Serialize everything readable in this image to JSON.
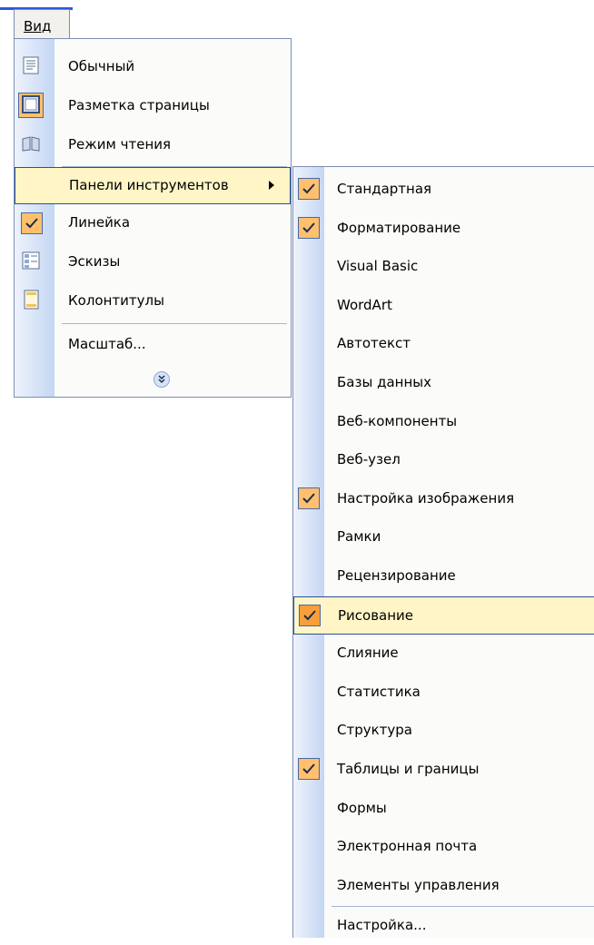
{
  "menubar": {
    "view_label": "Вид"
  },
  "view_menu": {
    "items": [
      {
        "label": "Обычный",
        "icon": "normal-view-icon"
      },
      {
        "label": "Разметка страницы",
        "icon": "page-layout-icon"
      },
      {
        "label": "Режим чтения",
        "icon": "reading-mode-icon"
      },
      {
        "label": "Панели инструментов",
        "icon": "submenu-arrow-icon",
        "highlighted": true
      },
      {
        "label": "Линейка",
        "checked": true
      },
      {
        "label": "Эскизы",
        "icon": "thumbnails-icon"
      },
      {
        "label": "Колонтитулы",
        "icon": "header-footer-icon"
      },
      {
        "label": "Масштаб..."
      }
    ],
    "expand_icon": "chevron-double-down-icon"
  },
  "toolbars_submenu": {
    "items": [
      {
        "label": "Стандартная",
        "checked": true
      },
      {
        "label": "Форматирование",
        "checked": true
      },
      {
        "label": "Visual Basic",
        "checked": false
      },
      {
        "label": "WordArt",
        "checked": false
      },
      {
        "label": "Автотекст",
        "checked": false
      },
      {
        "label": "Базы данных",
        "checked": false
      },
      {
        "label": "Веб-компоненты",
        "checked": false
      },
      {
        "label": "Веб-узел",
        "checked": false
      },
      {
        "label": "Настройка изображения",
        "checked": true
      },
      {
        "label": "Рамки",
        "checked": false
      },
      {
        "label": "Рецензирование",
        "checked": false
      },
      {
        "label": "Рисование",
        "checked": true,
        "highlighted": true
      },
      {
        "label": "Слияние",
        "checked": false
      },
      {
        "label": "Статистика",
        "checked": false
      },
      {
        "label": "Структура",
        "checked": false
      },
      {
        "label": "Таблицы и границы",
        "checked": true
      },
      {
        "label": "Формы",
        "checked": false
      },
      {
        "label": "Электронная почта",
        "checked": false
      },
      {
        "label": "Элементы управления",
        "checked": false
      },
      {
        "label": "Настройка..."
      }
    ]
  },
  "colors": {
    "highlight": "#fff5c6",
    "check_bg": "#ffc06e",
    "gutter": "#c4d6f3",
    "border": "#7a8fb2"
  }
}
